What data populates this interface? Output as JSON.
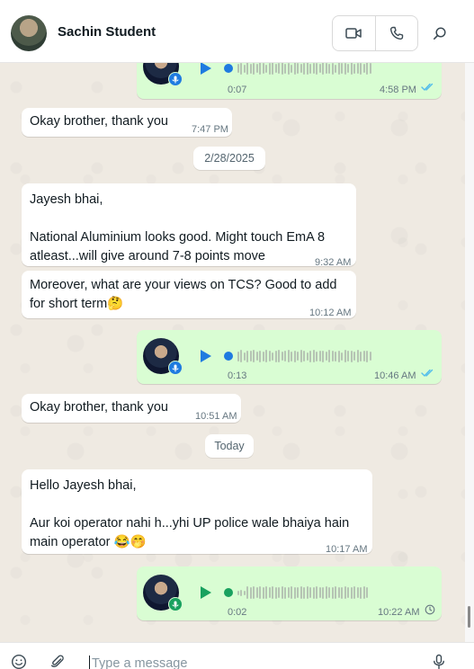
{
  "header": {
    "contact_name": "Sachin Student",
    "icons": [
      "video-call-icon",
      "voice-call-icon",
      "search-icon"
    ]
  },
  "messages": [
    {
      "type": "voice",
      "direction": "out",
      "duration": "0:07",
      "time": "4:58 PM",
      "status": "read"
    },
    {
      "type": "text",
      "direction": "in",
      "text": "Okay brother, thank you",
      "time": "7:47 PM"
    },
    {
      "type": "date",
      "label": "2/28/2025"
    },
    {
      "type": "text",
      "direction": "in",
      "text": "Jayesh bhai,\n\nNational Aluminium looks good. Might touch EmA 8 atleast...will give around 7-8 points move",
      "time": "9:32 AM"
    },
    {
      "type": "text",
      "direction": "in",
      "text": "Moreover, what are your views on TCS? Good to add for short term🤔",
      "time": "10:12 AM"
    },
    {
      "type": "voice",
      "direction": "out",
      "duration": "0:13",
      "time": "10:46 AM",
      "status": "read"
    },
    {
      "type": "text",
      "direction": "in",
      "text": "Okay brother, thank you",
      "time": "10:51 AM"
    },
    {
      "type": "date",
      "label": "Today"
    },
    {
      "type": "text",
      "direction": "in",
      "text": "Hello Jayesh bhai,\n\nAur koi operator nahi h...yhi UP police wale bhaiya hain main operator 😂🤭",
      "time": "10:17 AM"
    },
    {
      "type": "voice",
      "direction": "out",
      "duration": "0:02",
      "time": "10:22 AM",
      "status": "pending"
    }
  ],
  "composer": {
    "placeholder": "Type a message",
    "value": ""
  },
  "colors": {
    "incoming_bubble": "#ffffff",
    "outgoing_bubble": "#d9fdd3",
    "played_accent": "#1f7be0",
    "unplayed_accent": "#19a15f",
    "read_ticks": "#53bdeb",
    "chat_background": "#efeae2"
  }
}
